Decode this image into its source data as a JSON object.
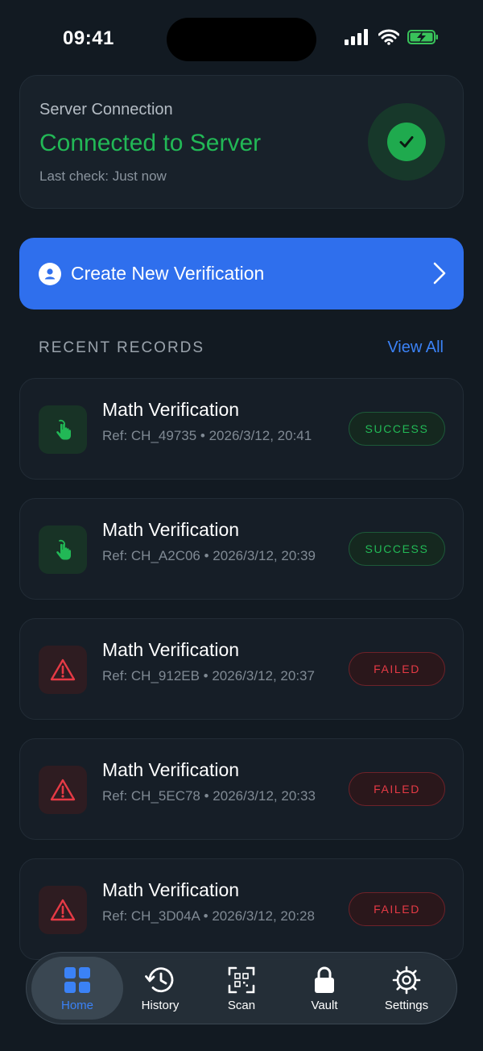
{
  "status_bar": {
    "time": "09:41"
  },
  "server": {
    "label": "Server Connection",
    "status": "Connected to Server",
    "last_check": "Last check: Just now"
  },
  "create_button": {
    "label": "Create New Verification"
  },
  "recent": {
    "heading": "RECENT RECORDS",
    "view_all": "View All",
    "records": [
      {
        "title": "Math Verification",
        "meta": "Ref: CH_49735 • 2026/3/12, 20:41",
        "status": "SUCCESS",
        "icon": "hand-tap-icon"
      },
      {
        "title": "Math Verification",
        "meta": "Ref: CH_A2C06 • 2026/3/12, 20:39",
        "status": "SUCCESS",
        "icon": "hand-tap-icon"
      },
      {
        "title": "Math Verification",
        "meta": "Ref: CH_912EB • 2026/3/12, 20:37",
        "status": "FAILED",
        "icon": "warning-icon"
      },
      {
        "title": "Math Verification",
        "meta": "Ref: CH_5EC78 • 2026/3/12, 20:33",
        "status": "FAILED",
        "icon": "warning-icon"
      },
      {
        "title": "Math Verification",
        "meta": "Ref: CH_3D04A • 2026/3/12, 20:28",
        "status": "FAILED",
        "icon": "warning-icon"
      }
    ]
  },
  "tabs": [
    {
      "label": "Home",
      "icon": "grid-icon",
      "active": true
    },
    {
      "label": "History",
      "icon": "history-icon",
      "active": false
    },
    {
      "label": "Scan",
      "icon": "qr-scan-icon",
      "active": false
    },
    {
      "label": "Vault",
      "icon": "lock-icon",
      "active": false
    },
    {
      "label": "Settings",
      "icon": "gear-icon",
      "active": false
    }
  ],
  "colors": {
    "background": "#121a22",
    "accent": "#2f6fed",
    "success": "#22b856",
    "failed": "#e53a45"
  }
}
